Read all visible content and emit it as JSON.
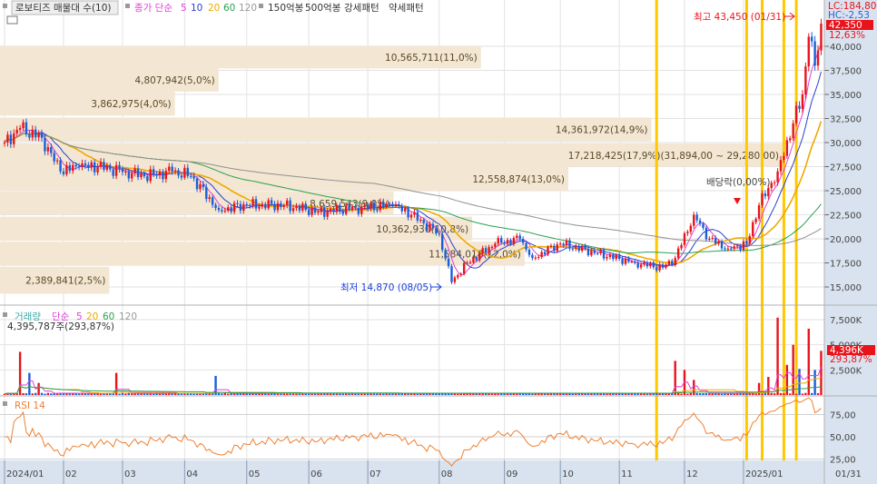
{
  "legend": {
    "title": "로보티즈 매물대 수(10)",
    "ma_label": "종가 단순",
    "ma_periods": [
      "5",
      "10",
      "20",
      "60",
      "120"
    ],
    "extras": [
      "150억봉",
      "500억봉",
      "강세패턴",
      "약세패턴"
    ]
  },
  "volume_legend": {
    "title": "거래량",
    "ma_label": "단순",
    "ma_periods": [
      "5",
      "20",
      "60",
      "120"
    ],
    "current": "4,395,787주(293,87%)"
  },
  "rsi_legend": {
    "title": "RSI 14"
  },
  "right_panel": {
    "lc": "LC:184,80",
    "hc": "HC:-2,53",
    "price_badge": "42,350",
    "price_change": "12,63%",
    "volume_badge": "4,396K",
    "volume_change": "293,87%"
  },
  "annotations": {
    "high": "최고 43,450 (01/31)",
    "low": "최저 14,870 (08/05)",
    "dividend": "배당락(0,00%)"
  },
  "colors": {
    "up": "#e8141c",
    "down": "#1a5fd6",
    "ma5": "#e040d8",
    "ma10": "#2a3fd0",
    "ma20": "#f0a800",
    "ma60": "#2aa050",
    "ma120": "#909090",
    "band": "#f3e6d2",
    "signal": "#ffc800",
    "rsi": "#f08030",
    "axis_bg": "#d9e3ef"
  },
  "chart_data": {
    "type": "candlestick",
    "price_axis": {
      "ticks": [
        15000,
        17500,
        20000,
        22500,
        25000,
        27500,
        30000,
        32500,
        35000,
        37500,
        40000
      ],
      "tick_labels": [
        "15,000",
        "17,500",
        "20,000",
        "22,500",
        "25,000",
        "27,500",
        "30,000",
        "32,500",
        "35,000",
        "37,500",
        "40,000"
      ]
    },
    "x_ticks": [
      {
        "day": 0,
        "label": "2024/01"
      },
      {
        "day": 19,
        "label": "02"
      },
      {
        "day": 38,
        "label": "03"
      },
      {
        "day": 58,
        "label": "04"
      },
      {
        "day": 78,
        "label": "05"
      },
      {
        "day": 98,
        "label": "06"
      },
      {
        "day": 117,
        "label": "07"
      },
      {
        "day": 140,
        "label": "08"
      },
      {
        "day": 161,
        "label": "09"
      },
      {
        "day": 179,
        "label": "10"
      },
      {
        "day": 198,
        "label": "11"
      },
      {
        "day": 219,
        "label": "12"
      },
      {
        "day": 238,
        "label": "2025/01"
      }
    ],
    "last_date_label": "01/31",
    "close_anchors": [
      [
        0,
        30000
      ],
      [
        5,
        31500
      ],
      [
        12,
        30500
      ],
      [
        18,
        27000
      ],
      [
        24,
        27500
      ],
      [
        30,
        27500
      ],
      [
        39,
        27000
      ],
      [
        45,
        26500
      ],
      [
        54,
        27000
      ],
      [
        60,
        26500
      ],
      [
        69,
        23000
      ],
      [
        78,
        23500
      ],
      [
        90,
        23500
      ],
      [
        101,
        22800
      ],
      [
        113,
        23200
      ],
      [
        125,
        23500
      ],
      [
        131,
        22500
      ],
      [
        140,
        20500
      ],
      [
        144,
        15500
      ],
      [
        149,
        17500
      ],
      [
        158,
        19500
      ],
      [
        166,
        20000
      ],
      [
        170,
        18000
      ],
      [
        179,
        19500
      ],
      [
        191,
        18500
      ],
      [
        203,
        17500
      ],
      [
        212,
        17000
      ],
      [
        216,
        18000
      ],
      [
        222,
        22500
      ],
      [
        227,
        20000
      ],
      [
        233,
        19000
      ],
      [
        239,
        19500
      ],
      [
        243,
        23500
      ],
      [
        249,
        27000
      ],
      [
        254,
        32000
      ],
      [
        257,
        35000
      ],
      [
        259,
        41000
      ],
      [
        261,
        38000
      ],
      [
        263,
        42350
      ]
    ],
    "high": {
      "value": 43450,
      "date": "01/31"
    },
    "low": {
      "value": 14870,
      "date": "08/05"
    },
    "volume_profile": [
      {
        "from": 40000,
        "to": 37700,
        "volume": "10,565,711(11,0%)",
        "share": 11.0
      },
      {
        "from": 37700,
        "to": 35300,
        "volume": "4,807,942(5,0%)",
        "share": 5.0
      },
      {
        "from": 35300,
        "to": 32800,
        "volume": "3,862,975(4,0%)",
        "share": 4.0
      },
      {
        "from": 32600,
        "to": 30100,
        "volume": "14,361,972(14,9%)",
        "share": 14.9
      },
      {
        "from": 29900,
        "to": 27500,
        "volume": "17,218,425(17,9%)(31,894,00 ~ 29,280,00)",
        "share": 17.9
      },
      {
        "from": 27500,
        "to": 25000,
        "volume": "12,558,874(13,0%)",
        "share": 13.0
      },
      {
        "from": 24900,
        "to": 22500,
        "volume": "8,659,543(9,0%)",
        "share": 9.0
      },
      {
        "from": 22300,
        "to": 19800,
        "volume": "10,362,930(10,8%)",
        "share": 10.8
      },
      {
        "from": 19700,
        "to": 17200,
        "volume": "11,584,018(12,0%)",
        "share": 12.0
      },
      {
        "from": 17100,
        "to": 14300,
        "volume": "2,389,841(2,5%)",
        "share": 2.5
      }
    ],
    "volume_axis": {
      "ticks": [
        2500,
        5000,
        7500
      ],
      "tick_labels": [
        "2,500K",
        "5,000K",
        "7,500K"
      ]
    },
    "volume_spikes_k": [
      [
        5,
        4300
      ],
      [
        8,
        2200
      ],
      [
        11,
        1200
      ],
      [
        36,
        2200
      ],
      [
        68,
        1900
      ],
      [
        216,
        3400
      ],
      [
        219,
        2500
      ],
      [
        222,
        1500
      ],
      [
        243,
        1200
      ],
      [
        246,
        1800
      ],
      [
        249,
        7700
      ],
      [
        252,
        3000
      ],
      [
        254,
        5000
      ],
      [
        256,
        2600
      ],
      [
        259,
        6600
      ],
      [
        261,
        2500
      ],
      [
        263,
        4396
      ]
    ],
    "rsi_axis": {
      "ticks": [
        25,
        50,
        75
      ],
      "tick_labels": [
        "25,00",
        "50,00",
        "75,00"
      ]
    },
    "signal_days": [
      210,
      239,
      244,
      251,
      255
    ]
  }
}
